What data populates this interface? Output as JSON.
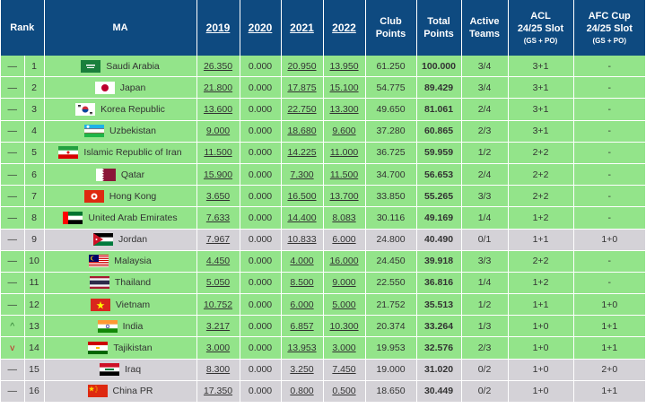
{
  "headers": {
    "rank": "Rank",
    "ma": "MA",
    "y2019": "2019",
    "y2020": "2020",
    "y2021": "2021",
    "y2022": "2022",
    "club_points": [
      "Club",
      "Points"
    ],
    "total_points": [
      "Total",
      "Points"
    ],
    "active_teams": [
      "Active",
      "Teams"
    ],
    "acl": [
      "ACL",
      "24/25 Slot",
      "(GS + PO)"
    ],
    "afc_cup": [
      "AFC Cup",
      "24/25 Slot",
      "(GS + PO)"
    ]
  },
  "colors": {
    "header_bg": "#0e4a80",
    "row_green": "#93e48a",
    "row_grey": "#d4d2d7",
    "link": "#1f4e8c"
  },
  "rows": [
    {
      "trend": "—",
      "trend_type": "same",
      "rank": "1",
      "country": "Saudi Arabia",
      "flag": "saudi-arabia-flag-icon",
      "y2019": "26.350",
      "y2020": "0.000",
      "y2021": "20.950",
      "y2022": "13.950",
      "club": "61.250",
      "total": "100.000",
      "active": "3/4",
      "acl": "3+1",
      "afc": "-",
      "bg": "green"
    },
    {
      "trend": "—",
      "trend_type": "same",
      "rank": "2",
      "country": "Japan",
      "flag": "japan-flag-icon",
      "y2019": "21.800",
      "y2020": "0.000",
      "y2021": "17.875",
      "y2022": "15.100",
      "club": "54.775",
      "total": "89.429",
      "active": "3/4",
      "acl": "3+1",
      "afc": "-",
      "bg": "green"
    },
    {
      "trend": "—",
      "trend_type": "same",
      "rank": "3",
      "country": "Korea Republic",
      "flag": "korea-republic-flag-icon",
      "y2019": "13.600",
      "y2020": "0.000",
      "y2021": "22.750",
      "y2022": "13.300",
      "club": "49.650",
      "total": "81.061",
      "active": "2/4",
      "acl": "3+1",
      "afc": "-",
      "bg": "green"
    },
    {
      "trend": "—",
      "trend_type": "same",
      "rank": "4",
      "country": "Uzbekistan",
      "flag": "uzbekistan-flag-icon",
      "y2019": "9.000",
      "y2020": "0.000",
      "y2021": "18.680",
      "y2022": "9.600",
      "club": "37.280",
      "total": "60.865",
      "active": "2/3",
      "acl": "3+1",
      "afc": "-",
      "bg": "green"
    },
    {
      "trend": "—",
      "trend_type": "same",
      "rank": "5",
      "country": "Islamic Republic of Iran",
      "flag": "iran-flag-icon",
      "y2019": "11.500",
      "y2020": "0.000",
      "y2021": "14.225",
      "y2022": "11.000",
      "club": "36.725",
      "total": "59.959",
      "active": "1/2",
      "acl": "2+2",
      "afc": "-",
      "bg": "green"
    },
    {
      "trend": "—",
      "trend_type": "same",
      "rank": "6",
      "country": "Qatar",
      "flag": "qatar-flag-icon",
      "y2019": "15.900",
      "y2020": "0.000",
      "y2021": "7.300",
      "y2022": "11.500",
      "club": "34.700",
      "total": "56.653",
      "active": "2/4",
      "acl": "2+2",
      "afc": "-",
      "bg": "green"
    },
    {
      "trend": "—",
      "trend_type": "same",
      "rank": "7",
      "country": "Hong Kong",
      "flag": "hong-kong-flag-icon",
      "y2019": "3.650",
      "y2020": "0.000",
      "y2021": "16.500",
      "y2022": "13.700",
      "club": "33.850",
      "total": "55.265",
      "active": "3/3",
      "acl": "2+2",
      "afc": "-",
      "bg": "green"
    },
    {
      "trend": "—",
      "trend_type": "same",
      "rank": "8",
      "country": "United Arab Emirates",
      "flag": "uae-flag-icon",
      "y2019": "7.633",
      "y2020": "0.000",
      "y2021": "14.400",
      "y2022": "8.083",
      "club": "30.116",
      "total": "49.169",
      "active": "1/4",
      "acl": "1+2",
      "afc": "-",
      "bg": "green"
    },
    {
      "trend": "—",
      "trend_type": "same",
      "rank": "9",
      "country": "Jordan",
      "flag": "jordan-flag-icon",
      "y2019": "7.967",
      "y2020": "0.000",
      "y2021": "10.833",
      "y2022": "6.000",
      "club": "24.800",
      "total": "40.490",
      "active": "0/1",
      "acl": "1+1",
      "afc": "1+0",
      "bg": "grey"
    },
    {
      "trend": "—",
      "trend_type": "same",
      "rank": "10",
      "country": "Malaysia",
      "flag": "malaysia-flag-icon",
      "y2019": "4.450",
      "y2020": "0.000",
      "y2021": "4.000",
      "y2022": "16.000",
      "club": "24.450",
      "total": "39.918",
      "active": "3/3",
      "acl": "2+2",
      "afc": "-",
      "bg": "green"
    },
    {
      "trend": "—",
      "trend_type": "same",
      "rank": "11",
      "country": "Thailand",
      "flag": "thailand-flag-icon",
      "y2019": "5.050",
      "y2020": "0.000",
      "y2021": "8.500",
      "y2022": "9.000",
      "club": "22.550",
      "total": "36.816",
      "active": "1/4",
      "acl": "1+2",
      "afc": "-",
      "bg": "green"
    },
    {
      "trend": "—",
      "trend_type": "same",
      "rank": "12",
      "country": "Vietnam",
      "flag": "vietnam-flag-icon",
      "y2019": "10.752",
      "y2020": "0.000",
      "y2021": "6.000",
      "y2022": "5.000",
      "club": "21.752",
      "total": "35.513",
      "active": "1/2",
      "acl": "1+1",
      "afc": "1+0",
      "bg": "green"
    },
    {
      "trend": "^",
      "trend_type": "up",
      "rank": "13",
      "country": "India",
      "flag": "india-flag-icon",
      "y2019": "3.217",
      "y2020": "0.000",
      "y2021": "6.857",
      "y2022": "10.300",
      "club": "20.374",
      "total": "33.264",
      "active": "1/3",
      "acl": "1+0",
      "afc": "1+1",
      "bg": "green"
    },
    {
      "trend": "v",
      "trend_type": "down",
      "rank": "14",
      "country": "Tajikistan",
      "flag": "tajikistan-flag-icon",
      "y2019": "3.000",
      "y2020": "0.000",
      "y2021": "13.953",
      "y2022": "3.000",
      "club": "19.953",
      "total": "32.576",
      "active": "2/3",
      "acl": "1+0",
      "afc": "1+1",
      "bg": "green"
    },
    {
      "trend": "—",
      "trend_type": "same",
      "rank": "15",
      "country": "Iraq",
      "flag": "iraq-flag-icon",
      "y2019": "8.300",
      "y2020": "0.000",
      "y2021": "3.250",
      "y2022": "7.450",
      "club": "19.000",
      "total": "31.020",
      "active": "0/2",
      "acl": "1+0",
      "afc": "2+0",
      "bg": "grey"
    },
    {
      "trend": "—",
      "trend_type": "same",
      "rank": "16",
      "country": "China PR",
      "flag": "china-pr-flag-icon",
      "y2019": "17.350",
      "y2020": "0.000",
      "y2021": "0.800",
      "y2022": "0.500",
      "club": "18.650",
      "total": "30.449",
      "active": "0/2",
      "acl": "1+0",
      "afc": "1+1",
      "bg": "grey"
    }
  ]
}
